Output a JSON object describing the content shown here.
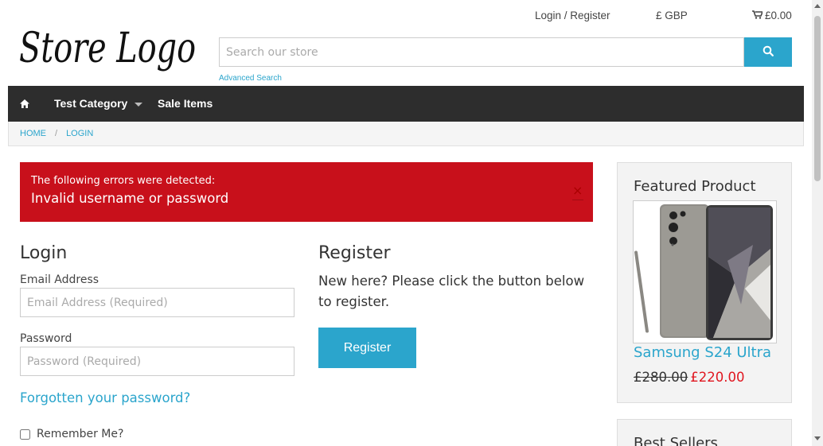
{
  "header": {
    "logo_text": "Store Logo",
    "login_register": "Login / Register",
    "currency": "£ GBP",
    "cart_total": "£0.00",
    "search_placeholder": "Search our store",
    "advanced_search": "Advanced Search"
  },
  "nav": {
    "home_icon": "home-icon",
    "items": [
      {
        "label": "Test Category",
        "has_dropdown": true
      },
      {
        "label": "Sale Items"
      }
    ]
  },
  "breadcrumb": {
    "home": "HOME",
    "separator": "/",
    "current": "LOGIN"
  },
  "alert": {
    "title": "The following errors were detected:",
    "message": "Invalid username or password",
    "close": "×",
    "color": "#c8101b"
  },
  "login": {
    "title": "Login",
    "email_label": "Email Address",
    "email_placeholder": "Email Address (Required)",
    "password_label": "Password",
    "password_placeholder": "Password (Required)",
    "forgot": "Forgotten your password?",
    "remember": "Remember Me?"
  },
  "register": {
    "title": "Register",
    "text": "New here? Please click the button below to register.",
    "button": "Register"
  },
  "sidebar": {
    "featured_title": "Featured Product",
    "product_name": "Samsung S24 Ultra",
    "old_price": "£280.00",
    "new_price": "£220.00",
    "best_sellers_title": "Best Sellers"
  },
  "colors": {
    "accent": "#2ba5cc",
    "nav_bg": "#2d2d2d",
    "sale_price": "#e0161f"
  }
}
